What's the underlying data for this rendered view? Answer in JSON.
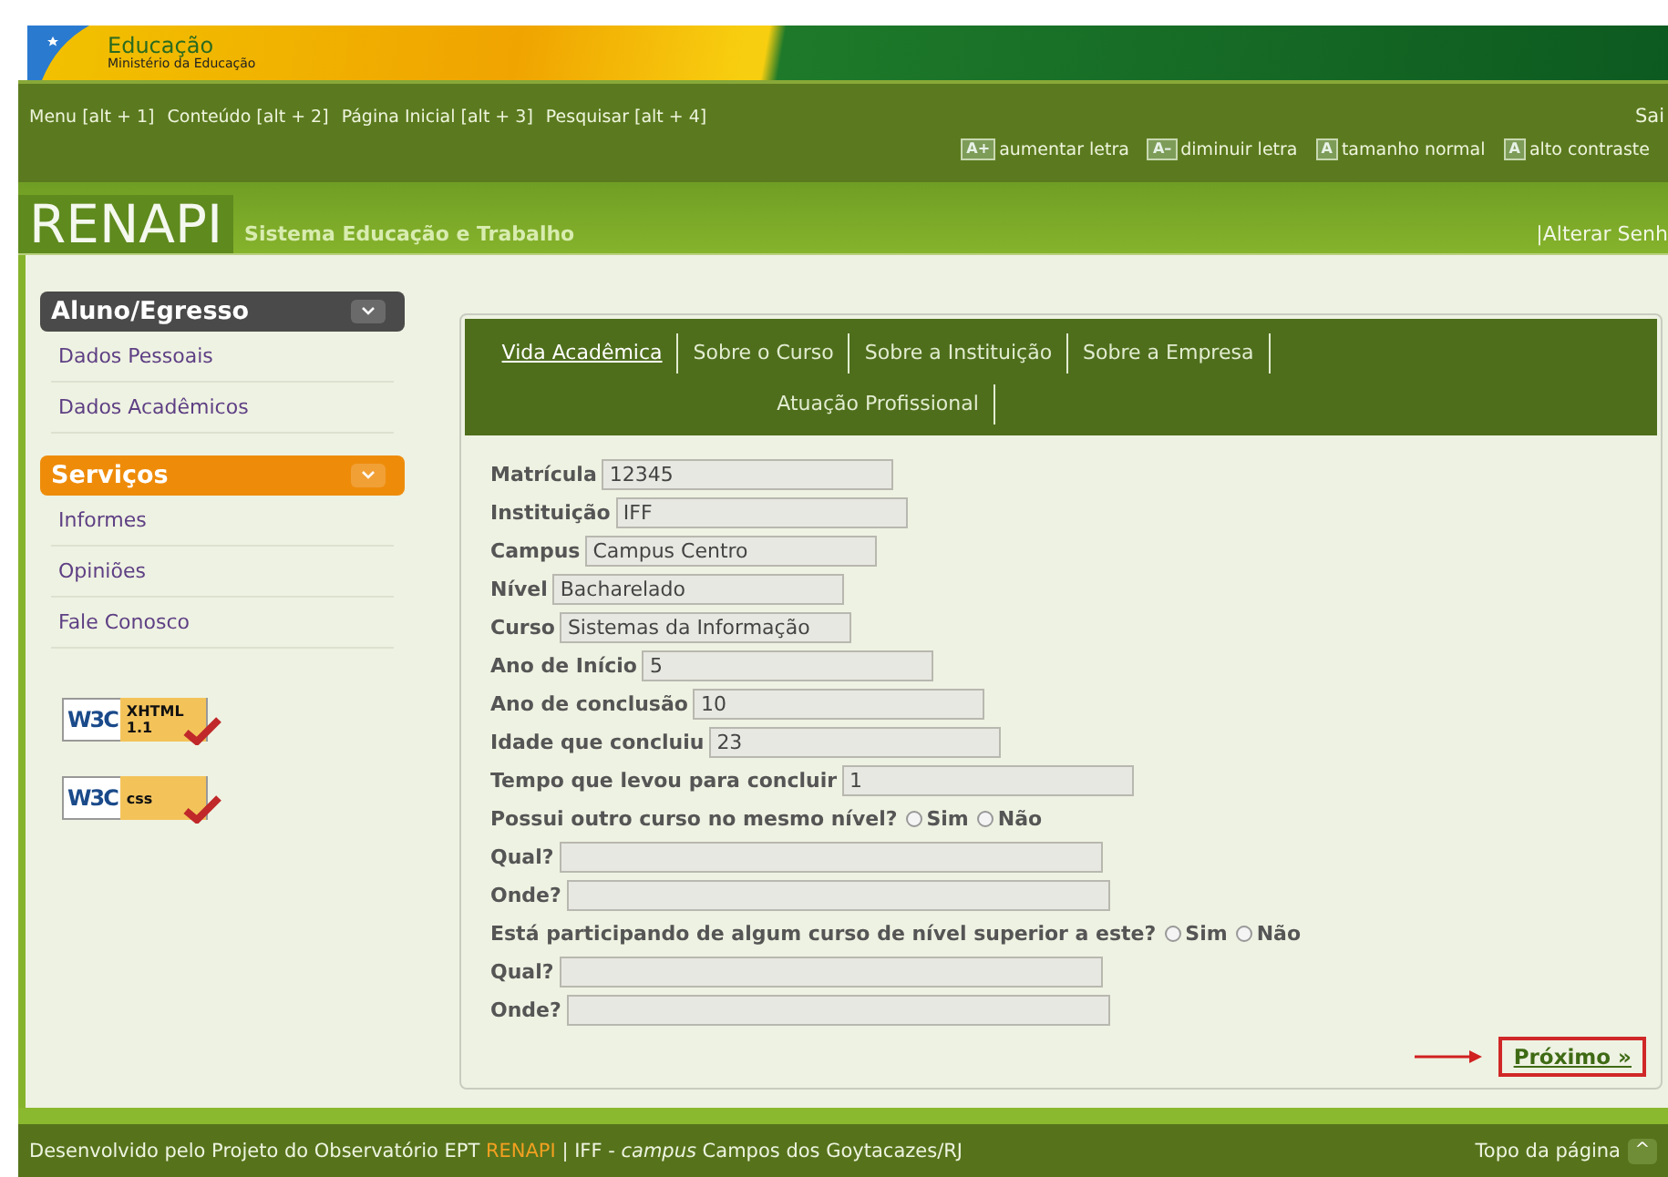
{
  "banner": {
    "title": "Educação",
    "subtitle": "Ministério da Educação"
  },
  "access_bar": {
    "shortcuts": [
      "Menu [alt + 1]",
      "Conteúdo [alt + 2]",
      "Página Inicial [alt + 3]",
      "Pesquisar [alt + 4]"
    ],
    "exit": "Sai",
    "font_tools": [
      {
        "icon": "A+",
        "label": "aumentar letra"
      },
      {
        "icon": "A–",
        "label": "diminuir letra"
      },
      {
        "icon": "A",
        "label": "tamanho normal"
      },
      {
        "icon": "A",
        "label": "alto contraste"
      }
    ]
  },
  "logo_bar": {
    "logo": "RENAPI",
    "tagline": "Sistema Educação e Trabalho",
    "link": "|Alterar Senh"
  },
  "sidebar": {
    "sections": [
      {
        "title": "Aluno/Egresso",
        "color": "#4a4a4a",
        "items": [
          "Dados Pessoais",
          "Dados Acadêmicos"
        ]
      },
      {
        "title": "Serviços",
        "color": "#ee8c0a",
        "items": [
          "Informes",
          "Opiniões",
          "Fale Conosco"
        ]
      }
    ],
    "badges": [
      {
        "logo": "W3C",
        "label": "XHTML",
        "version": "1.1"
      },
      {
        "logo": "W3C",
        "label": "css"
      }
    ]
  },
  "tabs": [
    {
      "label": "Vida Acadêmica",
      "selected": true
    },
    {
      "label": "Sobre o Curso",
      "selected": false
    },
    {
      "label": "Sobre a Instituição",
      "selected": false
    },
    {
      "label": "Sobre a Empresa",
      "selected": false
    },
    {
      "label": "Atuação Profissional",
      "selected": false
    }
  ],
  "form": [
    {
      "kind": "text",
      "label": "Matrícula",
      "value": "12345"
    },
    {
      "kind": "text",
      "label": "Instituição",
      "value": "IFF"
    },
    {
      "kind": "text",
      "label": "Campus",
      "value": "Campus Centro"
    },
    {
      "kind": "text",
      "label": "Nível",
      "value": "Bacharelado"
    },
    {
      "kind": "text",
      "label": "Curso",
      "value": "Sistemas da Informação"
    },
    {
      "kind": "text",
      "label": "Ano de Início",
      "value": "5"
    },
    {
      "kind": "text",
      "label": "Ano de conclusão",
      "value": "10"
    },
    {
      "kind": "text",
      "label": "Idade que concluiu",
      "value": "23"
    },
    {
      "kind": "text",
      "label": "Tempo que levou para concluir",
      "value": "1"
    },
    {
      "kind": "question",
      "label": "Possui outro curso no mesmo nível?",
      "options": [
        {
          "label": "Sim",
          "selected": false
        },
        {
          "label": "Não",
          "selected": false
        }
      ]
    },
    {
      "kind": "long",
      "label": "Qual?"
    },
    {
      "kind": "long",
      "label": "Onde?"
    },
    {
      "kind": "question",
      "label": "Está participando de algum curso de nível superior a este?",
      "options": [
        {
          "label": "Sim",
          "selected": false
        },
        {
          "label": "Não",
          "selected": false
        }
      ]
    },
    {
      "kind": "long",
      "label": "Qual?"
    },
    {
      "kind": "long",
      "label": "Onde?"
    }
  ],
  "next_button": "Próximo »",
  "footer": {
    "before": "Desenvolvido pelo Projeto do Observatório EPT",
    "link": "RENAPI",
    "after": "| IFF - *campus* Campos dos Goytacazes/RJ",
    "top_link": "Topo da página",
    "top_icon": "^"
  }
}
